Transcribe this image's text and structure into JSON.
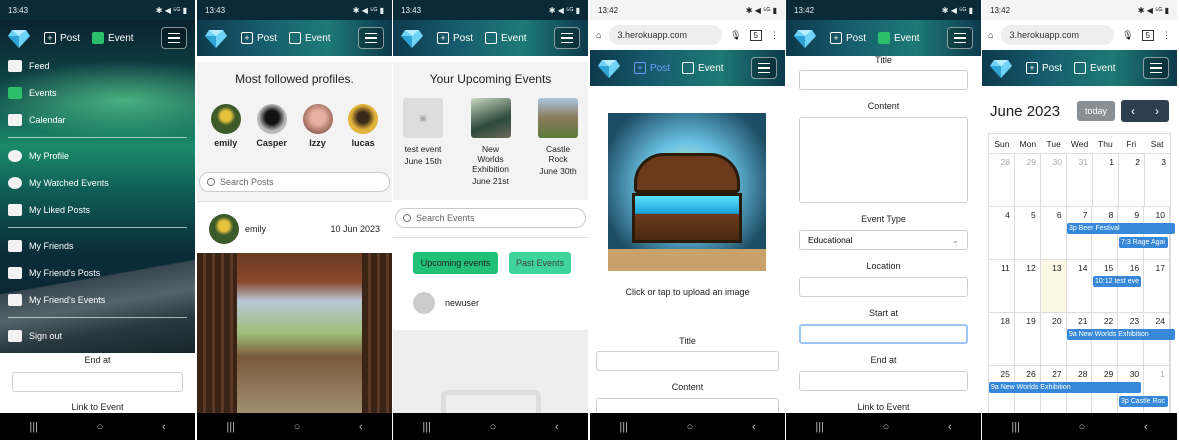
{
  "screens": [
    {
      "status_time": "13:43",
      "status_right": "✱ ◀ ⁵ᴳ ▮"
    },
    {
      "status_time": "13:43",
      "status_right": "✱ ◀ ⁵ᴳ ▮"
    },
    {
      "status_time": "13:43",
      "status_right": "✱ ◀ ⁵ᴳ ▮"
    },
    {
      "status_time": "13:42",
      "status_right": "✱ ◀ ⁵ᴳ ▮"
    },
    {
      "status_time": "13:42",
      "status_right": "✱ ◀ ⁵ᴳ ▮"
    },
    {
      "status_time": "13:42",
      "status_right": "✱ ◀ ⁵ᴳ ▮"
    }
  ],
  "nav": {
    "post": "Post",
    "event": "Event",
    "post_icon": "+",
    "event_icon": "▦"
  },
  "browser": {
    "url": "3.herokuapp.com",
    "tab_count": "5"
  },
  "menu": {
    "items_a": [
      {
        "label": "Feed",
        "icon": "feed-icon"
      },
      {
        "label": "Events",
        "icon": "calendar-x-icon"
      },
      {
        "label": "Calendar",
        "icon": "calendar-icon"
      }
    ],
    "items_b": [
      {
        "label": "My Profile",
        "icon": "user-icon"
      },
      {
        "label": "My Watched Events",
        "icon": "eye-icon"
      },
      {
        "label": "My Liked Posts",
        "icon": "thumbs-up-icon"
      }
    ],
    "items_c": [
      {
        "label": "My Friends",
        "icon": "users-icon"
      },
      {
        "label": "My Friend's Posts",
        "icon": "comment-icon"
      },
      {
        "label": "My Friend's Events",
        "icon": "calendar-icon"
      }
    ],
    "signout": "Sign out",
    "end_at": "End at",
    "link_to_event": "Link to Event"
  },
  "profiles": {
    "title": "Most followed profiles.",
    "users": [
      {
        "name": "emily",
        "color": "#3d5a2a"
      },
      {
        "name": "Casper",
        "color": "#555"
      },
      {
        "name": "Izzy",
        "color": "#b98a7a"
      },
      {
        "name": "lucas",
        "color": "#c98a2a"
      }
    ],
    "search_placeholder": "Search Posts",
    "post_author": "emily",
    "post_date": "10 Jun 2023"
  },
  "upcoming": {
    "title": "Your Upcoming Events",
    "events": [
      {
        "name": "test event",
        "date": "June 15th"
      },
      {
        "name": "New Worlds Exhibition",
        "date": "June 21st"
      },
      {
        "name": "Castle Rock",
        "date": "June 30th"
      }
    ],
    "search_placeholder": "Search Events",
    "btn_upcoming": "Upcoming events",
    "btn_past": "Past Events",
    "user": "newuser"
  },
  "upload": {
    "prompt": "Click or tap to upload an image",
    "title": "Title",
    "content": "Content"
  },
  "form": {
    "title": "Title",
    "content": "Content",
    "event_type": "Event Type",
    "event_type_value": "Educational",
    "location": "Location",
    "start_at": "Start at",
    "end_at": "End at",
    "link": "Link to Event"
  },
  "calendar": {
    "month": "June 2023",
    "today": "today",
    "dow": [
      "Sun",
      "Mon",
      "Tue",
      "Wed",
      "Thu",
      "Fri",
      "Sat"
    ],
    "weeks": [
      [
        "28",
        "29",
        "30",
        "31",
        "1",
        "2",
        "3"
      ],
      [
        "4",
        "5",
        "6",
        "7",
        "8",
        "9",
        "10"
      ],
      [
        "11",
        "12",
        "13",
        "14",
        "15",
        "16",
        "17"
      ],
      [
        "18",
        "19",
        "20",
        "21",
        "22",
        "23",
        "24"
      ],
      [
        "25",
        "26",
        "27",
        "28",
        "29",
        "30",
        "1"
      ]
    ],
    "events": [
      "3p Beer Festival",
      "7:3 Rage Agai",
      "10:12 test eve",
      "9a New Worlds Exhibition",
      "9a New Worlds Exhibition",
      "3p Castle Roc"
    ]
  }
}
